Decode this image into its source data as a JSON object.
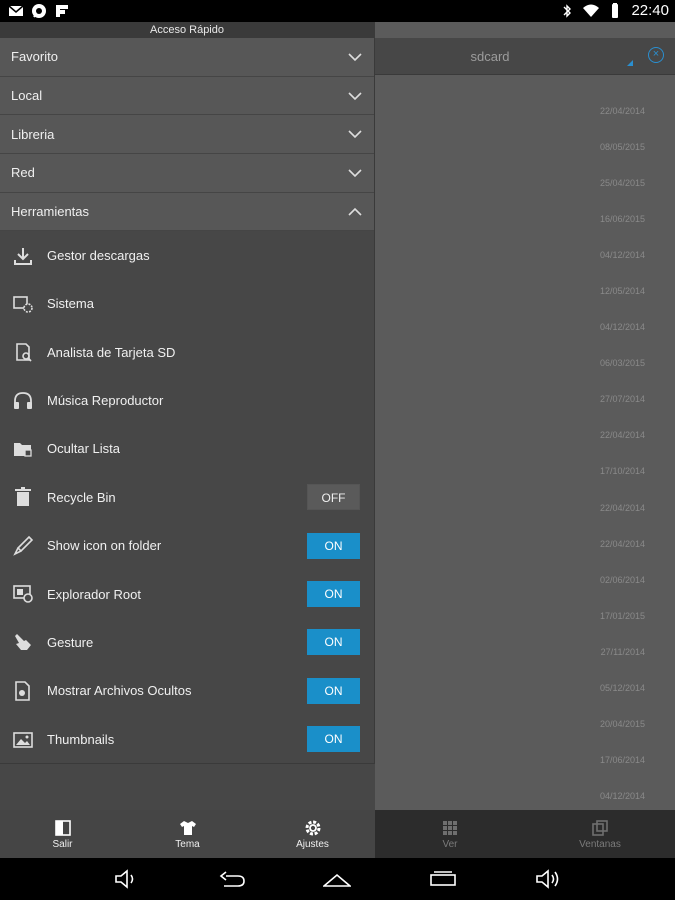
{
  "status_bar": {
    "time": "22:40",
    "left_icons": [
      "mail-icon",
      "chat-icon",
      "flipboard-icon"
    ],
    "right_icons": [
      "bluetooth-icon",
      "wifi-icon",
      "battery-icon"
    ]
  },
  "drawer": {
    "title": "Acceso Rápido",
    "categories": [
      {
        "label": "Favorito",
        "expanded": false
      },
      {
        "label": "Local",
        "expanded": false
      },
      {
        "label": "Libreria",
        "expanded": false
      },
      {
        "label": "Red",
        "expanded": false
      },
      {
        "label": "Herramientas",
        "expanded": true
      }
    ],
    "tools": [
      {
        "label": "Gestor descargas",
        "icon": "download-icon"
      },
      {
        "label": "Sistema",
        "icon": "system-settings-icon"
      },
      {
        "label": "Analista de Tarjeta SD",
        "icon": "sd-card-analyzer-icon"
      },
      {
        "label": "Música Reproductor",
        "icon": "headphones-icon"
      },
      {
        "label": "Ocultar Lista",
        "icon": "hidden-folder-icon"
      },
      {
        "label": "Recycle Bin",
        "icon": "trash-icon",
        "toggle": "OFF"
      },
      {
        "label": "Show icon on folder",
        "icon": "brush-icon",
        "toggle": "ON"
      },
      {
        "label": "Explorador Root",
        "icon": "root-explorer-icon",
        "toggle": "ON"
      },
      {
        "label": "Gesture",
        "icon": "gesture-hand-icon",
        "toggle": "ON"
      },
      {
        "label": "Mostrar Archivos Ocultos",
        "icon": "hidden-files-icon",
        "toggle": "ON"
      },
      {
        "label": "Thumbnails",
        "icon": "thumbnail-image-icon",
        "toggle": "ON"
      }
    ]
  },
  "file_pane": {
    "path": "sdcard",
    "dates": [
      "22/04/2014",
      "08/05/2015",
      "25/04/2015",
      "16/06/2015",
      "04/12/2014",
      "12/05/2014",
      "04/12/2014",
      "06/03/2015",
      "27/07/2014",
      "22/04/2014",
      "17/10/2014",
      "22/04/2014",
      "22/04/2014",
      "02/06/2014",
      "17/01/2015",
      "27/11/2014",
      "05/12/2014",
      "20/04/2015",
      "17/06/2014",
      "04/12/2014"
    ]
  },
  "toolbar": {
    "left": [
      {
        "label": "Salir",
        "icon": "exit-icon"
      },
      {
        "label": "Tema",
        "icon": "shirt-icon"
      },
      {
        "label": "Ajustes",
        "icon": "gear-icon"
      }
    ],
    "right": [
      {
        "label": "Ver",
        "icon": "grid-view-icon"
      },
      {
        "label": "Ventanas",
        "icon": "windows-icon"
      }
    ]
  },
  "nav_bar": [
    "volume-down-icon",
    "back-icon",
    "home-icon",
    "recents-icon",
    "volume-up-icon"
  ],
  "colors": {
    "accent": "#1a8fc9",
    "drawer_bg": "#474747",
    "category_bg": "#575757"
  }
}
